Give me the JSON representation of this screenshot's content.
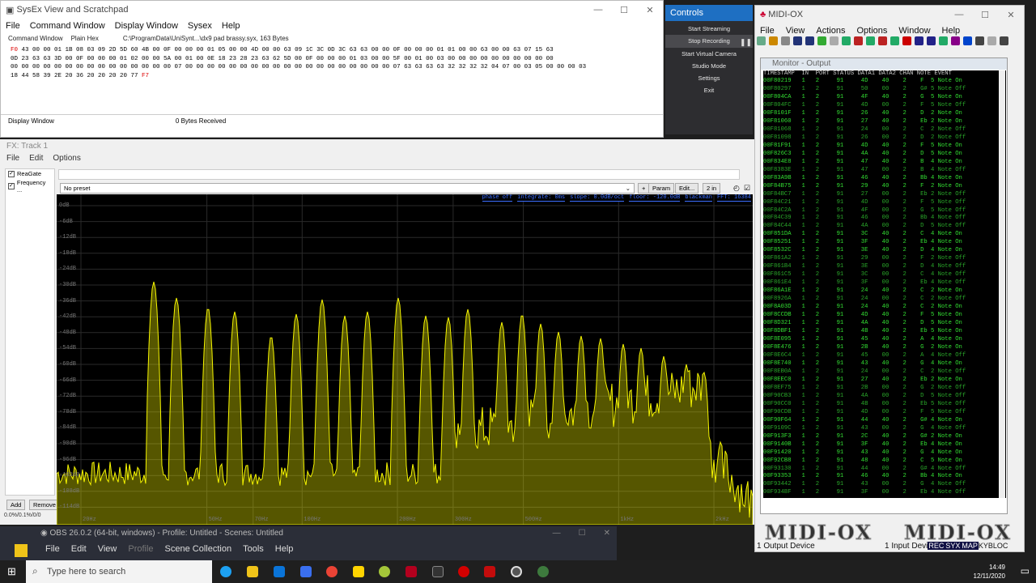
{
  "sysex": {
    "title": "SysEx View and Scratchpad",
    "menu": [
      "File",
      "Command Window",
      "Display Window",
      "Sysex",
      "Help"
    ],
    "heads": [
      "Command Window",
      "Plain Hex",
      "C:\\ProgramData\\UniSynt...\\dx9 pad brassy.syx, 163 Bytes"
    ],
    "hex_lines": [
      [
        "F0",
        "43 00 00 01 1B 08 03 09 2D 5D 60 4B 00 0F 00 00 00 01 05 00 00 4D 00 00 63 09 1C 3C 0D 3C 63 63 00 00 0F 00 00 00 01 01 00 00 63 00 00 63 07 15 63"
      ],
      [
        "",
        "0D 23 63 63 3D 00 0F 00 00 00 01 02 00 00 5A 00 01 00 0E 18 23 28 23 63 62 5D 00 0F 00 00 00 01 03 00 00 5F 00 01 00 03 00 00 00 00 00 00 00 00 00 00"
      ],
      [
        "",
        "00 00 00 00 00 00 00 00 00 00 00 00 00 00 00 07 00 00 00 00 00 00 00 00 00 00 00 00 00 00 00 00 00 00 00 07 63 63 63 63 32 32 32 32 04 07 00 03 05 00 00 00 03"
      ],
      [
        "",
        "18 44 58 39 2E 20 36 20 20 20 20 77"
      ]
    ],
    "hex_end": "F7",
    "footer_label": "Display Window",
    "bytes_received": "0  Bytes Received"
  },
  "controls": {
    "title": "Controls",
    "buttons": [
      "Start Streaming",
      "Stop Recording",
      "Start Virtual Camera",
      "Studio Mode",
      "Settings",
      "Exit"
    ]
  },
  "fx": {
    "title": "FX: Track 1",
    "menu": [
      "File",
      "Edit",
      "Options"
    ],
    "plugins": [
      "ReaGate",
      "Frequency ..."
    ],
    "add_label": "Add",
    "remove_label": "Remove",
    "cpu": "0.0%/0.1%/0/0",
    "preset": "No preset",
    "plus": "+",
    "param": "Param",
    "edit": "Edit...",
    "io": "2 in",
    "stats": [
      "phase off",
      "integrate: 0ms",
      "slope: 0.0dB/oct",
      "floor: -120.0dB",
      "blackman",
      "FFT: 16384"
    ],
    "db_labels": [
      "0dB",
      "-6dB",
      "-12dB",
      "-18dB",
      "-24dB",
      "-30dB",
      "-36dB",
      "-42dB",
      "-48dB",
      "-54dB",
      "-60dB",
      "-66dB",
      "-72dB",
      "-78dB",
      "-84dB",
      "-90dB",
      "-96dB",
      "-102dB",
      "-108dB",
      "-114dB"
    ],
    "hz_labels": [
      "20Hz",
      "50Hz",
      "70Hz",
      "100Hz",
      "200Hz",
      "300Hz",
      "500Hz",
      "1kHz",
      "2kHz",
      "3kHz",
      "5kHz",
      "10kHz",
      "20kHz"
    ]
  },
  "midiox": {
    "title": "MIDI-OX",
    "menu": [
      "File",
      "View",
      "Actions",
      "Options",
      "Window",
      "Help"
    ],
    "monitor_title": "Monitor - Output",
    "header": "TIMESTAMP  IN  PORT STATUS DATA1 DATA2 CHAN NOTE EVENT",
    "rows": [
      [
        "00F80219",
        "1",
        "2",
        "91",
        "4D",
        "40",
        "2",
        "F  5",
        "Note On"
      ],
      [
        "00F80297",
        "1",
        "2",
        "91",
        "50",
        "00",
        "2",
        "G# 5",
        "Note Off"
      ],
      [
        "00F804CA",
        "1",
        "2",
        "91",
        "4F",
        "40",
        "2",
        "G  5",
        "Note On"
      ],
      [
        "00F804FC",
        "1",
        "2",
        "91",
        "4D",
        "00",
        "2",
        "F  5",
        "Note Off"
      ],
      [
        "00F8101F",
        "1",
        "2",
        "91",
        "26",
        "40",
        "2",
        "D  2",
        "Note On"
      ],
      [
        "00F81060",
        "1",
        "2",
        "91",
        "27",
        "40",
        "2",
        "Eb 2",
        "Note On"
      ],
      [
        "00F81068",
        "1",
        "2",
        "91",
        "24",
        "00",
        "2",
        "C  2",
        "Note Off"
      ],
      [
        "00F81098",
        "1",
        "2",
        "91",
        "26",
        "00",
        "2",
        "D  2",
        "Note Off"
      ],
      [
        "00F81F91",
        "1",
        "2",
        "91",
        "4D",
        "40",
        "2",
        "F  5",
        "Note On"
      ],
      [
        "00F826C3",
        "1",
        "2",
        "91",
        "4A",
        "40",
        "2",
        "D  5",
        "Note On"
      ],
      [
        "00F834E8",
        "1",
        "2",
        "91",
        "47",
        "40",
        "2",
        "B  4",
        "Note On"
      ],
      [
        "00F8383E",
        "1",
        "2",
        "91",
        "47",
        "00",
        "2",
        "B  4",
        "Note Off"
      ],
      [
        "00F83A9B",
        "1",
        "2",
        "91",
        "46",
        "40",
        "2",
        "Bb 4",
        "Note On"
      ],
      [
        "00F84B75",
        "1",
        "2",
        "91",
        "29",
        "40",
        "2",
        "F  2",
        "Note On"
      ],
      [
        "00F84BC7",
        "1",
        "2",
        "91",
        "27",
        "00",
        "2",
        "Eb 2",
        "Note Off"
      ],
      [
        "00F84C21",
        "1",
        "2",
        "91",
        "4D",
        "00",
        "2",
        "F  5",
        "Note Off"
      ],
      [
        "00F84C2A",
        "1",
        "2",
        "91",
        "4F",
        "00",
        "2",
        "G  5",
        "Note Off"
      ],
      [
        "00F84C39",
        "1",
        "2",
        "91",
        "46",
        "00",
        "2",
        "Bb 4",
        "Note Off"
      ],
      [
        "00F84C44",
        "1",
        "2",
        "91",
        "4A",
        "00",
        "2",
        "D  5",
        "Note Off"
      ],
      [
        "00F851DA",
        "1",
        "2",
        "91",
        "3C",
        "40",
        "2",
        "C  4",
        "Note On"
      ],
      [
        "00F85251",
        "1",
        "2",
        "91",
        "3F",
        "40",
        "2",
        "Eb 4",
        "Note On"
      ],
      [
        "00F8532C",
        "1",
        "2",
        "91",
        "3E",
        "40",
        "2",
        "D  4",
        "Note On"
      ],
      [
        "00F861A2",
        "1",
        "2",
        "91",
        "29",
        "00",
        "2",
        "F  2",
        "Note Off"
      ],
      [
        "00F861B4",
        "1",
        "2",
        "91",
        "3E",
        "00",
        "2",
        "D  4",
        "Note Off"
      ],
      [
        "00F861C5",
        "1",
        "2",
        "91",
        "3C",
        "00",
        "2",
        "C  4",
        "Note Off"
      ],
      [
        "00F861E4",
        "1",
        "2",
        "91",
        "3F",
        "00",
        "2",
        "Eb 4",
        "Note Off"
      ],
      [
        "00F86A1E",
        "1",
        "2",
        "91",
        "24",
        "40",
        "2",
        "C  2",
        "Note On"
      ],
      [
        "00F8926A",
        "1",
        "2",
        "91",
        "24",
        "00",
        "2",
        "C  2",
        "Note Off"
      ],
      [
        "00F8A03D",
        "1",
        "2",
        "91",
        "24",
        "40",
        "2",
        "C  2",
        "Note On"
      ],
      [
        "00F8CCDB",
        "1",
        "2",
        "91",
        "4D",
        "40",
        "2",
        "F  5",
        "Note On"
      ],
      [
        "00F8D321",
        "1",
        "2",
        "91",
        "4A",
        "40",
        "2",
        "D  5",
        "Note On"
      ],
      [
        "00F8DBF1",
        "1",
        "2",
        "91",
        "4B",
        "40",
        "2",
        "Eb 5",
        "Note On"
      ],
      [
        "00F8E095",
        "1",
        "2",
        "91",
        "45",
        "40",
        "2",
        "A  4",
        "Note On"
      ],
      [
        "00F8E476",
        "1",
        "2",
        "91",
        "2B",
        "40",
        "2",
        "G  2",
        "Note On"
      ],
      [
        "00F8E6C4",
        "1",
        "2",
        "91",
        "45",
        "00",
        "2",
        "A  4",
        "Note Off"
      ],
      [
        "00F8E740",
        "1",
        "2",
        "91",
        "43",
        "40",
        "2",
        "G  4",
        "Note On"
      ],
      [
        "00F8EB0A",
        "1",
        "2",
        "91",
        "24",
        "00",
        "2",
        "C  2",
        "Note Off"
      ],
      [
        "00F8EEC0",
        "1",
        "2",
        "91",
        "27",
        "40",
        "2",
        "Eb 2",
        "Note On"
      ],
      [
        "00F8EF75",
        "1",
        "2",
        "91",
        "2B",
        "00",
        "2",
        "G  2",
        "Note Off"
      ],
      [
        "00F90CB3",
        "1",
        "2",
        "91",
        "4A",
        "00",
        "2",
        "D  5",
        "Note Off"
      ],
      [
        "00F90CC0",
        "1",
        "2",
        "91",
        "4B",
        "00",
        "2",
        "Eb 5",
        "Note Off"
      ],
      [
        "00F90CDB",
        "1",
        "2",
        "91",
        "4D",
        "00",
        "2",
        "F  5",
        "Note Off"
      ],
      [
        "00F90F64",
        "1",
        "2",
        "91",
        "44",
        "40",
        "2",
        "G# 4",
        "Note On"
      ],
      [
        "00F9109C",
        "1",
        "2",
        "91",
        "43",
        "00",
        "2",
        "G  4",
        "Note Off"
      ],
      [
        "00F913F3",
        "1",
        "2",
        "91",
        "2C",
        "40",
        "2",
        "G# 2",
        "Note On"
      ],
      [
        "00F9140B",
        "1",
        "2",
        "91",
        "3F",
        "40",
        "2",
        "Eb 4",
        "Note On"
      ],
      [
        "00F91420",
        "1",
        "2",
        "91",
        "43",
        "40",
        "2",
        "G  4",
        "Note On"
      ],
      [
        "00F92CB8",
        "1",
        "2",
        "91",
        "48",
        "40",
        "2",
        "C  5",
        "Note On"
      ],
      [
        "00F93130",
        "1",
        "2",
        "91",
        "44",
        "00",
        "2",
        "G# 4",
        "Note Off"
      ],
      [
        "00F93353",
        "1",
        "2",
        "91",
        "46",
        "40",
        "2",
        "Bb 4",
        "Note On"
      ],
      [
        "00F93442",
        "1",
        "2",
        "91",
        "43",
        "00",
        "2",
        "G  4",
        "Note Off"
      ],
      [
        "00F934BF",
        "1",
        "2",
        "91",
        "3F",
        "00",
        "2",
        "Eb 4",
        "Note Off"
      ]
    ],
    "logo_text": "MIDI-OX",
    "status_left": "1 Output Device",
    "status_right": "1 Input Devi",
    "badges": [
      "REC",
      "SYX",
      "MAP"
    ],
    "status_tail": "KYBLOC"
  },
  "obs": {
    "title": "OBS 26.0.2 (64-bit, windows) - Profile: Untitled - Scenes: Untitled",
    "menu": [
      "File",
      "Edit",
      "View",
      "Profile",
      "Scene Collection",
      "Tools",
      "Help"
    ]
  },
  "taskbar": {
    "search_placeholder": "Type here to search",
    "time": "14:49",
    "date": "12/11/2020"
  },
  "colors": {
    "accent": "#1e6fc2",
    "midi_green": "#33e033",
    "spectrum": "#f5f500",
    "stats_blue": "#3b6eff"
  }
}
